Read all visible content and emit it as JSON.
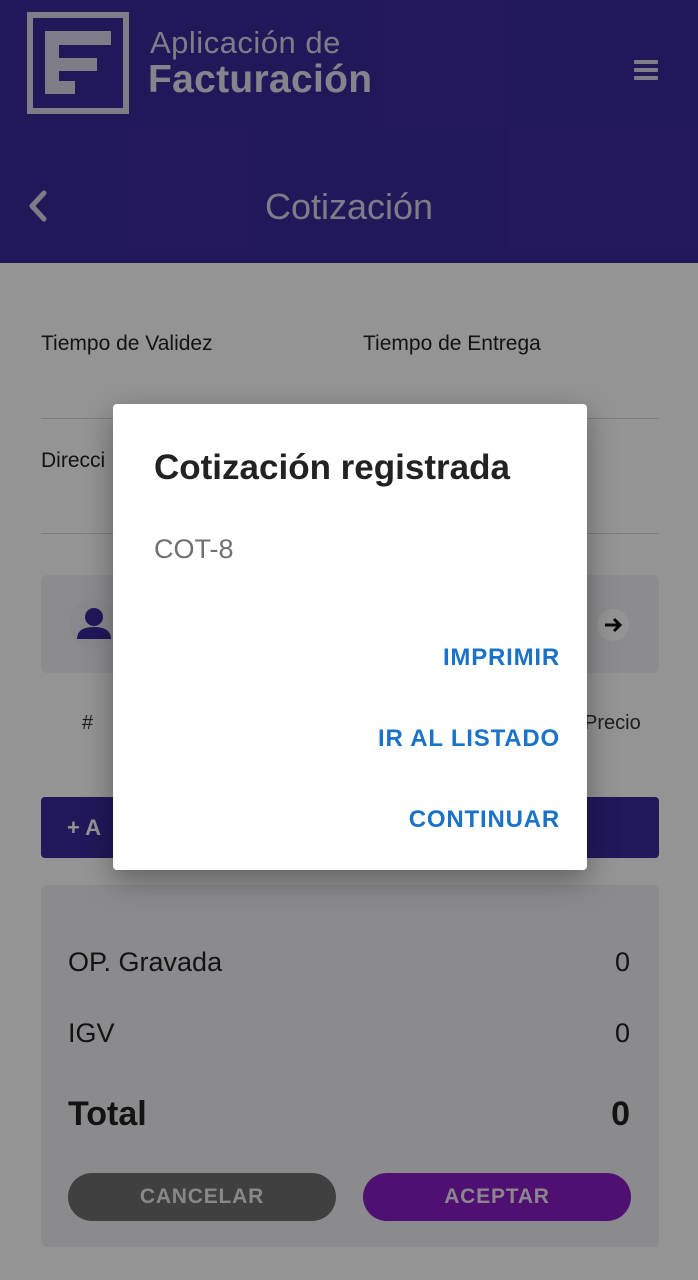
{
  "header": {
    "app_title_line1": "Aplicación de",
    "app_title_line2": "Facturación",
    "page_title": "Cotización"
  },
  "form": {
    "validity_label": "Tiempo de Validez",
    "delivery_label": "Tiempo de Entrega",
    "address_label": "Direcci"
  },
  "table": {
    "col_number": "#",
    "col_price": "Precio"
  },
  "add_button_label": "+ A",
  "totals": {
    "gravada_label": "OP. Gravada",
    "gravada_value": "0",
    "igv_label": "IGV",
    "igv_value": "0",
    "total_label": "Total",
    "total_value": "0"
  },
  "actions": {
    "cancel_label": "CANCELAR",
    "accept_label": "ACEPTAR"
  },
  "dialog": {
    "title": "Cotización registrada",
    "message": "COT-8",
    "print_label": "IMPRIMIR",
    "list_label": "IR AL LISTADO",
    "continue_label": "CONTINUAR"
  },
  "colors": {
    "primary": "#3a2a9c",
    "accent": "#8a1dc4",
    "dialog_action": "#1a73c8"
  },
  "icons": {
    "logo": "logo-icon",
    "menu": "hamburger-menu-icon",
    "back": "back-chevron-icon",
    "person": "person-icon",
    "arrow": "arrow-right-icon"
  }
}
